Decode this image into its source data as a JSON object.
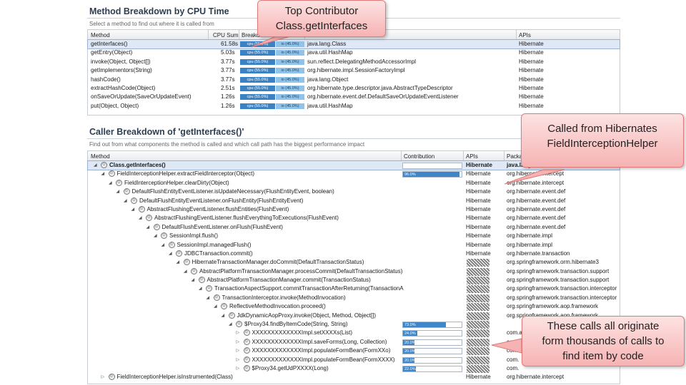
{
  "method_breakdown": {
    "title": "Method Breakdown by CPU Time",
    "subtitle": "Select a method to find out where it is called from",
    "columns": [
      "Method",
      "CPU Sum",
      "Breakdown",
      "Class",
      "APIs"
    ],
    "rows": [
      {
        "method": "getInterfaces()",
        "cpu": "61.58s",
        "cpu_label": "cpu (55.0%)",
        "io_label": "io (45.0%)",
        "class": "java.lang.Class",
        "api": "Hibernate"
      },
      {
        "method": "getEntry(Object)",
        "cpu": "5.03s",
        "cpu_label": "cpu (55.0%)",
        "io_label": "io (45.0%)",
        "class": "java.util.HashMap",
        "api": "Hibernate"
      },
      {
        "method": "invoke(Object, Object[])",
        "cpu": "3.77s",
        "cpu_label": "cpu (55.0%)",
        "io_label": "io (45.0%)",
        "class": "sun.reflect.DelegatingMethodAccessorImpl",
        "api": "Hibernate"
      },
      {
        "method": "getImplementors(String)",
        "cpu": "3.77s",
        "cpu_label": "cpu (55.0%)",
        "io_label": "io (45.0%)",
        "class": "org.hibernate.impl.SessionFactoryImpl",
        "api": "Hibernate"
      },
      {
        "method": "hashCode()",
        "cpu": "3.77s",
        "cpu_label": "cpu (55.0%)",
        "io_label": "io (45.0%)",
        "class": "java.lang.Object",
        "api": "Hibernate"
      },
      {
        "method": "extractHashCode(Object)",
        "cpu": "2.51s",
        "cpu_label": "cpu (55.0%)",
        "io_label": "io (45.0%)",
        "class": "org.hibernate.type.descriptor.java.AbstractTypeDescriptor",
        "api": "Hibernate"
      },
      {
        "method": "onSaveOrUpdate(SaveOrUpdateEvent)",
        "cpu": "1.26s",
        "cpu_label": "cpu (55.0%)",
        "io_label": "io (45.0%)",
        "class": "org.hibernate.event.def.DefaultSaveOrUpdateEventListener",
        "api": "Hibernate"
      },
      {
        "method": "put(Object, Object)",
        "cpu": "1.26s",
        "cpu_label": "cpu (55.0%)",
        "io_label": "io (45.0%)",
        "class": "java.util.HashMap",
        "api": "Hibernate"
      }
    ]
  },
  "caller_breakdown": {
    "title": "Caller Breakdown of 'getInterfaces()'",
    "subtitle": "Find out from what components the method is called and which call path has the biggest performance impact",
    "columns": [
      "Method",
      "Contribution",
      "APIs",
      "Package"
    ],
    "rows": [
      {
        "method": "Class.getInterfaces()",
        "contribution": "",
        "api": "Hibernate",
        "package": "java.lang"
      },
      {
        "method": "FieldInterceptionHelper.extractFieldInterceptor(Object)",
        "contribution": "96.0%",
        "api": "Hibernate",
        "package": "org.hibernate.intercept"
      },
      {
        "method": "FieldInterceptionHelper.clearDirty(Object)",
        "contribution": "",
        "api": "Hibernate",
        "package": "org.hibernate.intercept"
      },
      {
        "method": "DefaultFlushEntityEventListener.isUpdateNecessary(FlushEntityEvent, boolean)",
        "contribution": "",
        "api": "Hibernate",
        "package": "org.hibernate.event.def"
      },
      {
        "method": "DefaultFlushEntityEventListener.onFlushEntity(FlushEntityEvent)",
        "contribution": "",
        "api": "Hibernate",
        "package": "org.hibernate.event.def"
      },
      {
        "method": "AbstractFlushingEventListener.flushEntities(FlushEvent)",
        "contribution": "",
        "api": "Hibernate",
        "package": "org.hibernate.event.def"
      },
      {
        "method": "AbstractFlushingEventListener.flushEverythingToExecutions(FlushEvent)",
        "contribution": "",
        "api": "Hibernate",
        "package": "org.hibernate.event.def"
      },
      {
        "method": "DefaultFlushEventListener.onFlush(FlushEvent)",
        "contribution": "",
        "api": "Hibernate",
        "package": "org.hibernate.event.def"
      },
      {
        "method": "SessionImpl.flush()",
        "contribution": "",
        "api": "Hibernate",
        "package": "org.hibernate.impl"
      },
      {
        "method": "SessionImpl.managedFlush()",
        "contribution": "",
        "api": "Hibernate",
        "package": "org.hibernate.impl"
      },
      {
        "method": "JDBCTransaction.commit()",
        "contribution": "",
        "api": "Hibernate",
        "package": "org.hibernate.transaction"
      },
      {
        "method": "HibernateTransactionManager.doCommit(DefaultTransactionStatus)",
        "contribution": "",
        "api": "",
        "package": "org.springframework.orm.hibernate3"
      },
      {
        "method": "AbstractPlatformTransactionManager.processCommit(DefaultTransactionStatus)",
        "contribution": "",
        "api": "",
        "package": "org.springframework.transaction.support"
      },
      {
        "method": "AbstractPlatformTransactionManager.commit(TransactionStatus)",
        "contribution": "",
        "api": "",
        "package": "org.springframework.transaction.support"
      },
      {
        "method": "TransactionAspectSupport.commitTransactionAfterReturning(TransactionA",
        "contribution": "",
        "api": "",
        "package": "org.springframework.transaction.interceptor"
      },
      {
        "method": "TransactionInterceptor.invoke(MethodInvocation)",
        "contribution": "",
        "api": "",
        "package": "org.springframework.transaction.interceptor"
      },
      {
        "method": "ReflectiveMethodInvocation.proceed()",
        "contribution": "",
        "api": "",
        "package": "org.springframework.aop.framework"
      },
      {
        "method": "JdkDynamicAopProxy.invoke(Object, Method, Object[])",
        "contribution": "",
        "api": "",
        "package": "org.springframework.aop.framework"
      },
      {
        "method": "$Proxy34.findByItemCode(String, String)",
        "contribution": "73.0%",
        "api": "",
        "package": ""
      },
      {
        "method": "XXXXXXXXXXXXXImpl.setXXXXs(List)",
        "contribution": "24.0%",
        "api": "",
        "package": "com.a"
      },
      {
        "method": "XXXXXXXXXXXXXImpl.saveForms(Long, Collection)",
        "contribution": "20.0%",
        "api": "",
        "package": "com."
      },
      {
        "method": "XXXXXXXXXXXXXImpl.populateFormBean(FormXXo)",
        "contribution": "20.0%",
        "api": "",
        "package": "com."
      },
      {
        "method": "XXXXXXXXXXXXXImpl.populateFormBean(FormXXXX)",
        "contribution": "20.0%",
        "api": "",
        "package": "com."
      },
      {
        "method": "$Proxy34.getUdPXXXX(Long)",
        "contribution": "22.0%",
        "api": "",
        "package": "com."
      },
      {
        "method": "FieldInterceptionHelper.isInstrumented(Class)",
        "contribution": "",
        "api": "Hibernate",
        "package": "org.hibernate.intercept"
      }
    ]
  },
  "callouts": {
    "top": [
      "Top Contributor",
      "Class.getInterfaces"
    ],
    "hibernate": [
      "Called from Hibernates",
      "FieldInterceptionHelper"
    ],
    "thousands": [
      "These calls all originate",
      "form thousands of calls to",
      "find item by code"
    ]
  }
}
